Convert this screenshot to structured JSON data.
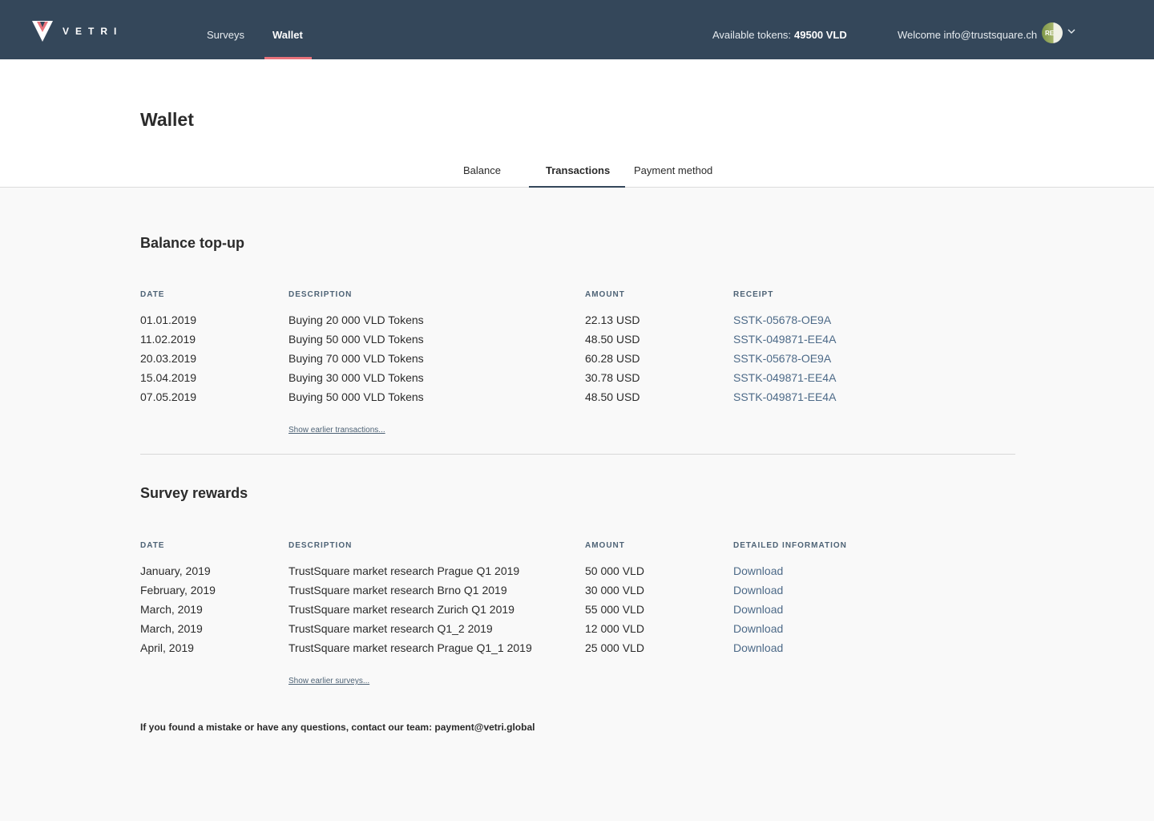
{
  "brand": {
    "name": "VETRI",
    "accent": "#e8737b",
    "navbar_color": "#34475a"
  },
  "nav": {
    "surveys": "Surveys",
    "wallet": "Wallet"
  },
  "header": {
    "tokens_label": "Available tokens:",
    "tokens_value": "49500 VLD",
    "welcome": "Welcome info@trustsquare.ch",
    "avatar_initials": "RE"
  },
  "page": {
    "title": "Wallet"
  },
  "tabs": {
    "balance": "Balance",
    "transactions": "Transactions",
    "payment": "Payment method"
  },
  "topup": {
    "title": "Balance top-up",
    "headers": {
      "date": "DATE",
      "description": "DESCRIPTION",
      "amount": "AMOUNT",
      "receipt": "RECEIPT"
    },
    "rows": [
      {
        "date": "01.01.2019",
        "description": "Buying 20 000 VLD Tokens",
        "amount": "22.13 USD",
        "receipt": "SSTK-05678-OE9A"
      },
      {
        "date": "11.02.2019",
        "description": "Buying 50 000 VLD Tokens",
        "amount": "48.50 USD",
        "receipt": "SSTK-049871-EE4A"
      },
      {
        "date": "20.03.2019",
        "description": "Buying 70 000 VLD Tokens",
        "amount": "60.28 USD",
        "receipt": "SSTK-05678-OE9A"
      },
      {
        "date": "15.04.2019",
        "description": "Buying 30 000 VLD Tokens",
        "amount": "30.78 USD",
        "receipt": "SSTK-049871-EE4A"
      },
      {
        "date": "07.05.2019",
        "description": "Buying 50 000 VLD Tokens",
        "amount": "48.50 USD",
        "receipt": "SSTK-049871-EE4A"
      }
    ],
    "show_earlier": "Show earlier transactions..."
  },
  "rewards": {
    "title": "Survey rewards",
    "headers": {
      "date": "DATE",
      "description": "DESCRIPTION",
      "amount": "AMOUNT",
      "info": "DETAILED INFORMATION"
    },
    "rows": [
      {
        "date": "January, 2019",
        "description": "TrustSquare market research Prague Q1 2019",
        "amount": "50 000 VLD",
        "info": "Download"
      },
      {
        "date": "February, 2019",
        "description": "TrustSquare market research Brno Q1 2019",
        "amount": "30 000 VLD",
        "info": "Download"
      },
      {
        "date": "March, 2019",
        "description": "TrustSquare market research Zurich Q1 2019",
        "amount": "55 000 VLD",
        "info": "Download"
      },
      {
        "date": "March, 2019",
        "description": "TrustSquare market research Q1_2 2019",
        "amount": "12 000 VLD",
        "info": "Download"
      },
      {
        "date": "April, 2019",
        "description": "TrustSquare market research Prague Q1_1 2019",
        "amount": "25 000 VLD",
        "info": "Download"
      }
    ],
    "show_earlier": "Show earlier surveys..."
  },
  "contact": "If you found a mistake or have any questions, contact our team: payment@vetri.global"
}
